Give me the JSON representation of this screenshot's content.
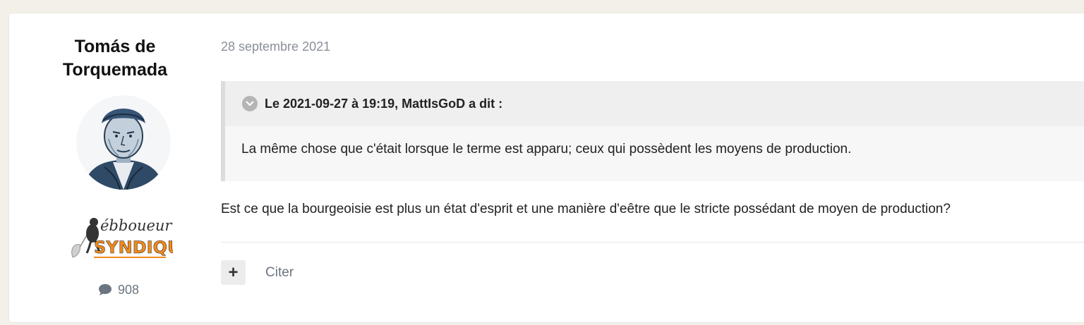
{
  "author": {
    "name": "Tomás de Torquemada",
    "post_count": "908",
    "rank_badge": "ébboueur SYNDIQUÉ"
  },
  "post": {
    "date": "28 septembre 2021",
    "quote": {
      "header": "Le 2021-09-27 à 19:19, MattIsGoD a dit :",
      "text": "La même chose que c'était lorsque le terme est apparu; ceux qui possèdent les moyens de production."
    },
    "text": "Est ce que la bourgeoisie est plus un état d'esprit et une manière d'eêtre que le stricte possédant de moyen de production?",
    "actions": {
      "plus_label": "+",
      "quote_label": "Citer"
    }
  },
  "colors": {
    "background": "#f3f0ea",
    "badge_orange": "#f28a1a",
    "muted": "#6c7580"
  },
  "icons": {
    "comment": "comment-icon",
    "quote_toggle": "chevron-down-icon"
  }
}
